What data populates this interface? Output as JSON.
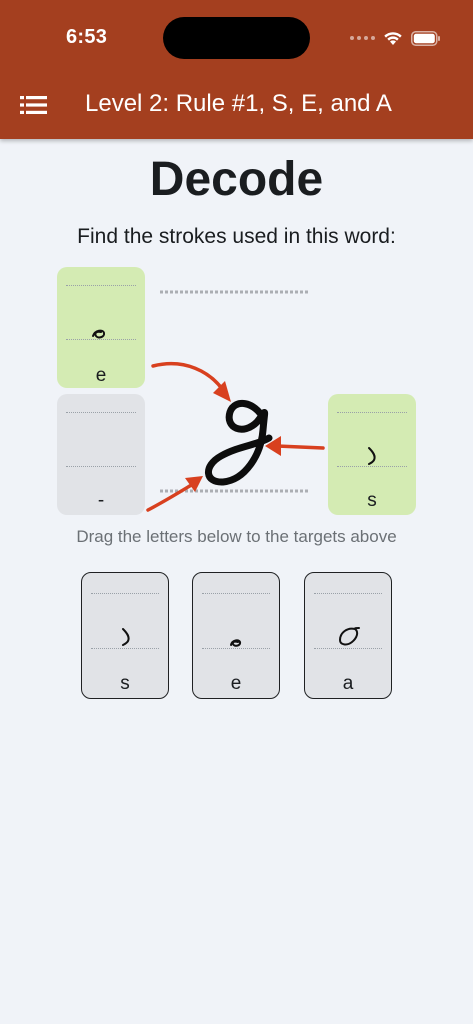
{
  "status_bar": {
    "time": "6:53"
  },
  "app_bar": {
    "title": "Level 2: Rule #1, S, E, and A",
    "menu_icon": "list-menu-icon",
    "background_color": "#a43f1f"
  },
  "main": {
    "heading": "Decode",
    "instruction": "Find the strokes used in this word:",
    "drag_hint": "Drag the letters below to the targets above"
  },
  "targets": [
    {
      "label": "e",
      "state": "filled",
      "color": "#d4ebb3"
    },
    {
      "label": "-",
      "state": "empty",
      "color": "#e1e3e7"
    },
    {
      "label": "s",
      "state": "filled",
      "color": "#d4ebb3"
    }
  ],
  "letter_tiles": [
    {
      "label": "s"
    },
    {
      "label": "e"
    },
    {
      "label": "a"
    }
  ],
  "colors": {
    "arrow": "#d8401f",
    "page_background": "#f0f3f8",
    "tile_background": "#e1e3e7"
  }
}
